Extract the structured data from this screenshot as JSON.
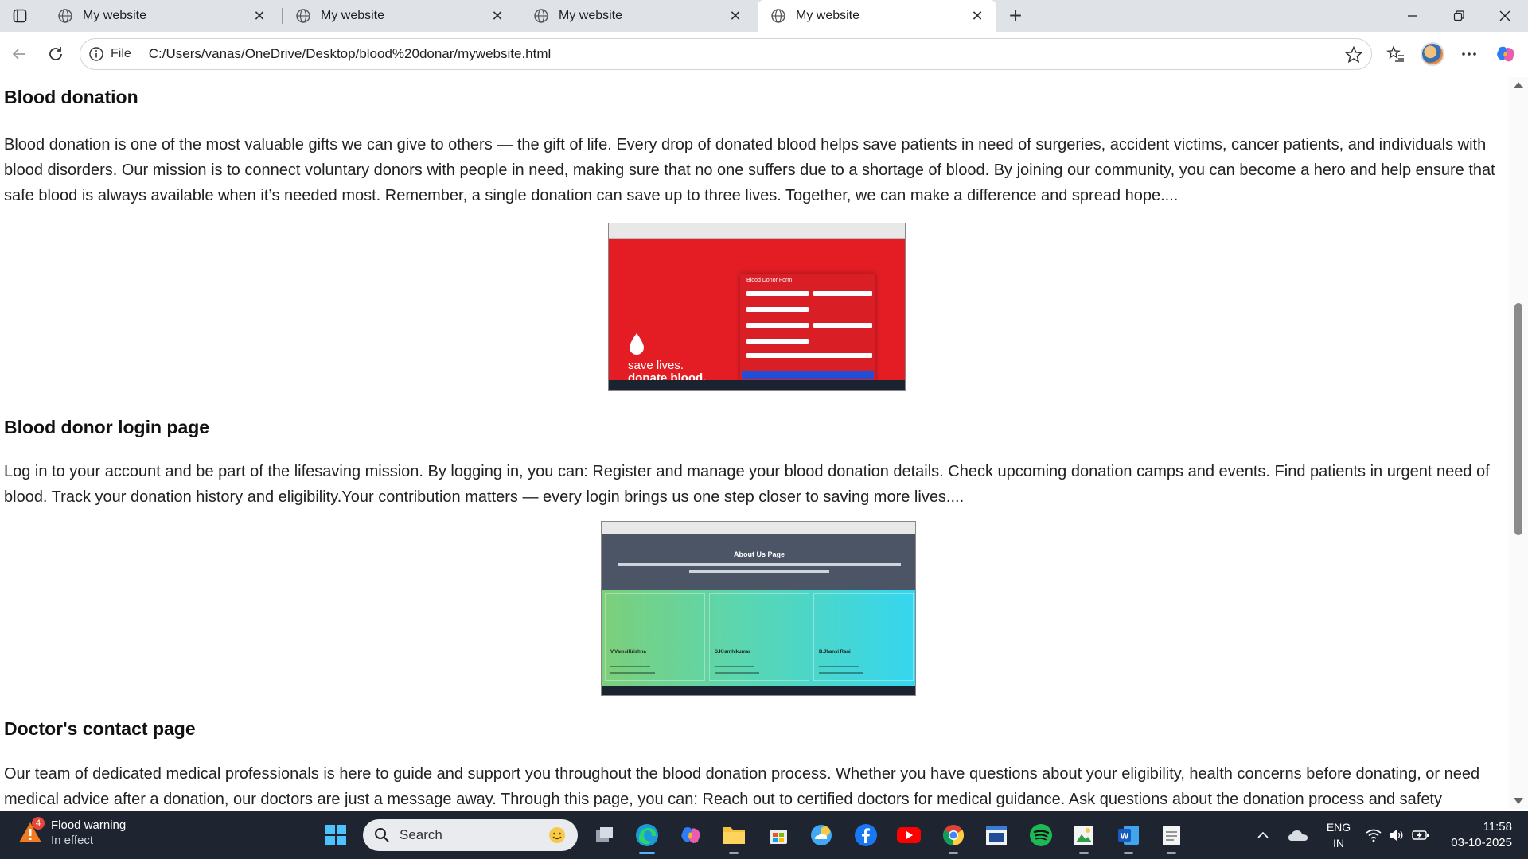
{
  "browser": {
    "tabs": [
      {
        "title": "My website",
        "active": false
      },
      {
        "title": "My website",
        "active": false
      },
      {
        "title": "My website",
        "active": false
      },
      {
        "title": "My website",
        "active": true
      }
    ],
    "address_scheme": "File",
    "address_url": "C:/Users/vanas/OneDrive/Desktop/blood%20donar/mywebsite.html"
  },
  "page": {
    "sections": [
      {
        "title": "Blood donation",
        "text": "Blood donation is one of the most valuable gifts we can give to others — the gift of life. Every drop of donated blood helps save patients in need of surgeries, accident victims, cancer patients, and individuals with blood disorders. Our mission is to connect voluntary donors with people in need, making sure that no one suffers due to a shortage of blood. By joining our community, you can become a hero and help ensure that safe blood is always available when it’s needed most. Remember, a single donation can save up to three lives. Together, we can make a difference and spread hope...."
      },
      {
        "title": "Blood donor login page",
        "text": "Log in to your account and be part of the lifesaving mission. By logging in, you can: Register and manage your blood donation details. Check upcoming donation camps and events. Find patients in urgent need of blood. Track your donation history and eligibility.Your contribution matters — every login brings us one step closer to saving more lives...."
      },
      {
        "title": "Doctor's contact page",
        "text": "Our team of dedicated medical professionals is here to guide and support you throughout the blood donation process. Whether you have questions about your eligibility, health concerns before donating, or need medical advice after a donation, our doctors are just a message away. Through this page, you can: Reach out to certified doctors for medical guidance. Ask questions about the donation process and safety"
      }
    ],
    "shot1": {
      "form_title": "Blood Donor Form",
      "slogan_line1": "save lives.",
      "slogan_line2": "donate blood."
    },
    "shot2": {
      "heading": "About Us Page",
      "cards": [
        "V.VamsiKrishna",
        "S.Kranthikumar",
        "B.Jhansi Rani"
      ]
    }
  },
  "taskbar": {
    "weather_title": "Flood warning",
    "weather_sub": "In effect",
    "weather_badge": "4",
    "search_placeholder": "Search",
    "lang_line1": "ENG",
    "lang_line2": "IN",
    "time": "11:58",
    "date": "03-10-2025"
  },
  "colors": {
    "accent_red": "#e41d25",
    "taskbar": "#1f2530",
    "tabstrip": "#dfe3e8"
  }
}
